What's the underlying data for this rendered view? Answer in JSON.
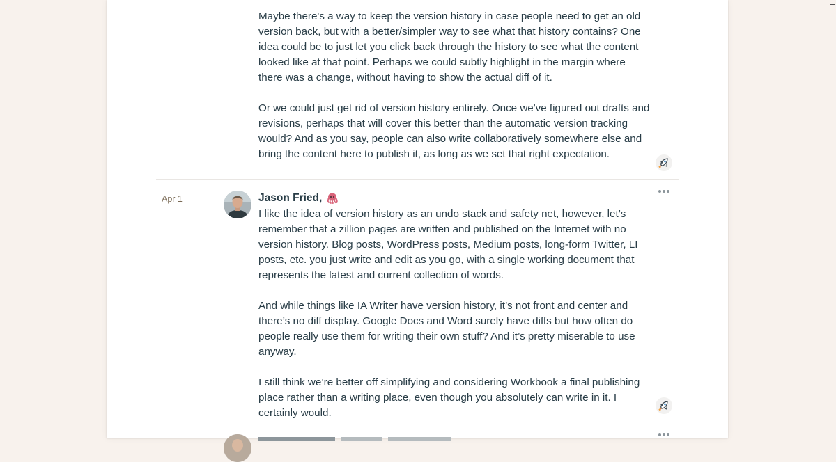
{
  "thread": {
    "previous_comment": {
      "paragraphs": [
        "Maybe there's a way to keep the version history in case people need to get an old version back, but with a better/simpler way to see what that history contains? One idea could be to just let you click back through the history to see what the content looked like at that point. Perhaps we could subtly highlight in the margin where there was a change, without having to show the actual diff of it.",
        "Or we could just get rid of version history entirely. Once we've figured out drafts and revisions, perhaps that will cover this better than the automatic version tracking would? And as you say, people can also write collaboratively somewhere else and bring the content here to publish it, as long as we set that right expectation."
      ],
      "boost_icon": "boost-rocket-icon"
    },
    "comment": {
      "date": "Apr 1",
      "author": "Jason Fried,",
      "author_emoji": "octopus-icon",
      "paragraphs": [
        "I like the idea of version history as an undo stack and safety net, however, let’s remember that a zillion pages are written and published on the Internet with no version history. Blog posts, WordPress posts, Medium posts, long-form Twitter, LI posts, etc. you just write and edit as you go, with a single working document that represents the latest and current collection of words.",
        "And while things like IA Writer have version history, it’s not front and center and there’s no diff display. Google Docs and Word surely have diffs but how often do people really use them for writing their own stuff? And it’s pretty miserable to use anyway.",
        "I still think we’re better off simplifying and considering Workbook a final publishing place rather than a writing place, even though you absolutely can write in it. I certainly would."
      ],
      "boost_icon": "boost-rocket-icon",
      "menu_icon": "more-options-icon"
    },
    "next_comment": {
      "menu_icon": "more-options-icon"
    }
  },
  "colors": {
    "background": "#f8f2ed",
    "panel": "#ffffff",
    "text": "#283c46",
    "date": "#7a6a55",
    "separator": "#e9e6e3"
  }
}
